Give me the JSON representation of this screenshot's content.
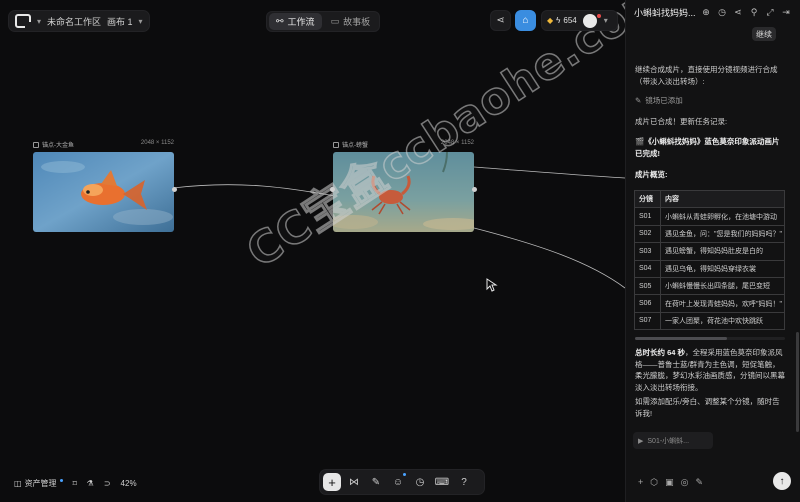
{
  "workspace": {
    "name": "未命名工作区",
    "canvas_name": "画布 1"
  },
  "tabs": [
    {
      "label": "工作流",
      "active": true
    },
    {
      "label": "故事板",
      "active": false
    }
  ],
  "credits": {
    "amount": "654"
  },
  "nodes": [
    {
      "title": "锚点-大金鱼",
      "size": "2048 × 1152"
    },
    {
      "title": "锚点-螃蟹",
      "size": "2048 × 1152"
    }
  ],
  "watermark": "CC宝盒ccbaohe.com",
  "bottom_left": {
    "assets_label": "资产管理",
    "zoom": "42%"
  },
  "panel": {
    "title": "小蝌蚪找妈妈...",
    "bubble": "继续",
    "msg1": "继续合成成片，直接使用分镜视频进行合成（带淡入淡出转场）:",
    "tool_line": "镜场已添加",
    "msg2": "成片已合成！更新任务记录:",
    "msg3": "🎬《小蝌蚪找妈妈》蓝色莫奈印象派动画片 已完成!",
    "overview": "成片概览:",
    "table": {
      "headers": [
        "分镜",
        "内容"
      ],
      "rows": [
        [
          "S01",
          "小蝌蚪从青蛙卵孵化，在池塘中游动"
        ],
        [
          "S02",
          "遇见金鱼，问：\"您是我们的妈妈吗？\""
        ],
        [
          "S03",
          "遇见螃蟹，得知妈妈肚皮是白的"
        ],
        [
          "S04",
          "遇见乌龟，得知妈妈穿绿衣裳"
        ],
        [
          "S05",
          "小蝌蚪慢慢长出四条腿，尾巴变短"
        ],
        [
          "S06",
          "在荷叶上发现青蛙妈妈，欢呼\"妈妈！\""
        ],
        [
          "S07",
          "一家人团聚，荷花池中欢快跳跃"
        ]
      ]
    },
    "summary_bold": "总时长约 64 秒",
    "summary_rest": "，全程采用蓝色莫奈印象派风格——普鲁士蓝/群青为主色调，短促笔触，柔光朦胧，梦幻水彩油画质感，分镜间以黑幕淡入淡出转场衔接。",
    "followup": "如需添加配乐/旁白、调整某个分镜，随时告诉我!",
    "attachment": "S01-小蝌蚪..."
  }
}
